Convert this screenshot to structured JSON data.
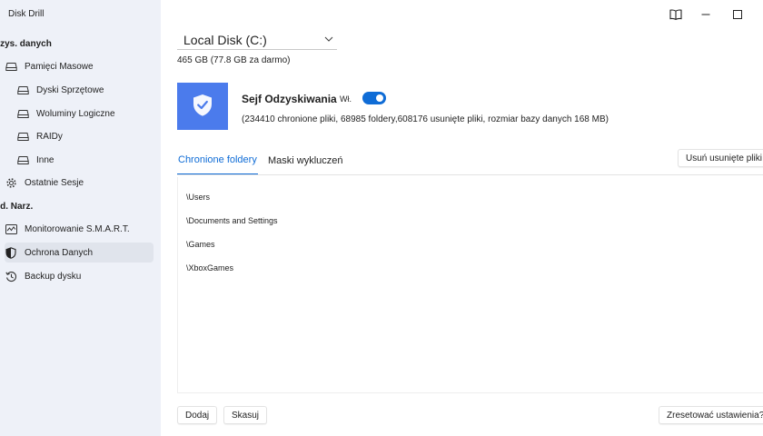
{
  "app": {
    "title": "Disk Drill"
  },
  "sidebar": {
    "section_recovery": "dzys. danych",
    "mass_storage": "Pamięci Masowe",
    "hardware_disks": "Dyski Sprzętowe",
    "logical_volumes": "Woluminy Logiczne",
    "raids": "RAIDy",
    "other": "Inne",
    "recent_sessions": "Ostatnie Sesje",
    "section_tools": "od. Narz.",
    "smart_monitoring": "Monitorowanie S.M.A.R.T.",
    "data_protection": "Ochrona Danych",
    "disk_backup": "Backup dysku"
  },
  "disk": {
    "selected": "Local Disk (C:)",
    "size_info": "465 GB (77.8 GB za darmo)"
  },
  "vault": {
    "title": "Sejf Odzyskiwania",
    "toggle_label": "Wł.",
    "toggle_on": true,
    "stats": "(234410 chronione pliki, 68985 foldery,608176 usunięte pliki, rozmiar bazy danych 168 MB)",
    "accent_color": "#4b7bec"
  },
  "tabs": {
    "protected_folders": "Chronione foldery",
    "exclusion_masks": "Maski wykluczeń"
  },
  "actions": {
    "remove_deleted": "Usuń usunięte pliki",
    "add": "Dodaj",
    "delete": "Skasuj",
    "reset": "Zresetować ustawienia?"
  },
  "folders": [
    "\\Users",
    "\\Documents and Settings",
    "\\Games",
    "\\XboxGames"
  ],
  "colors": {
    "accent": "#0f6cd6",
    "sidebar_bg": "#eef1f8",
    "active_item_bg": "#e0e4ec"
  }
}
